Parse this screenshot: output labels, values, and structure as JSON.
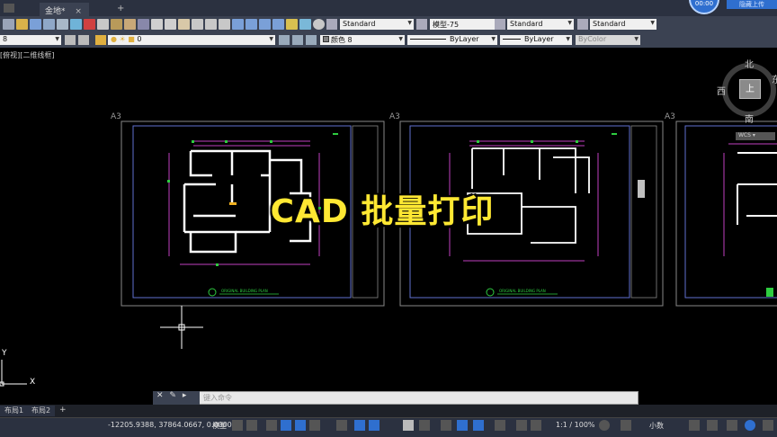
{
  "tabs": [
    {
      "label": "金地*",
      "active": true
    }
  ],
  "tab_add": "+",
  "tab_close": "×",
  "cloud": {
    "time": "00:00",
    "button": "隐藏上传"
  },
  "toolbar1": {
    "text_style": "Standard",
    "dim_style": "模型-75",
    "table_style": "Standard",
    "mleader_style": "Standard"
  },
  "toolbar2": {
    "workspace": "8",
    "layer": "0",
    "color": "颜色 8",
    "linetype": "ByLayer",
    "lineweight": "ByLayer",
    "plotstyle": "ByColor"
  },
  "viewport_label": "[俯视][二维线框]",
  "viewcube": {
    "north": "北",
    "south": "南",
    "west": "西",
    "east": "东",
    "face": "上",
    "wcs": "WCS ▾"
  },
  "sheets": [
    {
      "label": "A3",
      "title": "ORIGINAL BUILDING PLAN"
    },
    {
      "label": "A3",
      "title": "ORIGINAL BUILDING PLAN"
    },
    {
      "label": "A3",
      "title": ""
    }
  ],
  "overlay_title": "CAD 批量打印",
  "command_line": {
    "placeholder": "键入命令"
  },
  "layout_tabs": [
    "布局1",
    "布局2"
  ],
  "layout_add": "+",
  "ucs_x": "X",
  "ucs_y": "Y",
  "status": {
    "coords": "-12205.9388, 37864.0667, 0.0000",
    "mode": "模型",
    "scale": "1:1 / 100%",
    "units": "小数"
  },
  "colors": {
    "accent": "#ffe833",
    "toolbar": "#3b4252",
    "canvas": "#000000",
    "magenta": "#c040c0",
    "green": "#2ecc40"
  }
}
